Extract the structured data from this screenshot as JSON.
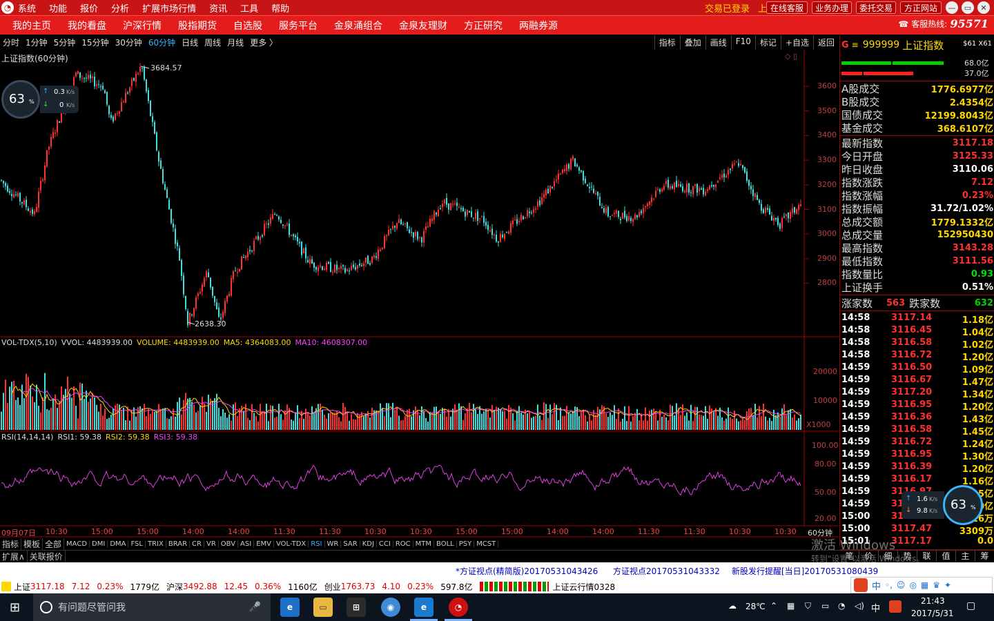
{
  "title_bar": {
    "menus": [
      "系统",
      "功能",
      "报价",
      "分析",
      "扩展市场行情",
      "资讯",
      "工具",
      "帮助"
    ],
    "status": "交易已登录",
    "index_name": "上证指数",
    "buttons": [
      "在线客服",
      "业务办理",
      "委托交易",
      "方正网站"
    ],
    "window_controls": [
      "—",
      "▭",
      "✕"
    ]
  },
  "nav": {
    "items": [
      "我的主页",
      "我的看盘",
      "沪深行情",
      "股指期货",
      "自选股",
      "服务平台",
      "金泉涌组合",
      "金泉友理财",
      "方正研究",
      "两融券源"
    ],
    "hotline_label": "客服热线:",
    "hotline_number": "95571"
  },
  "period_bar": {
    "periods": [
      "分时",
      "1分钟",
      "5分钟",
      "15分钟",
      "30分钟",
      "60分钟",
      "日线",
      "周线",
      "月线",
      "更多 〉"
    ],
    "active_index": 5,
    "tools": [
      "指标",
      "叠加",
      "画线",
      "F10",
      "标记",
      "+自选",
      "返回"
    ]
  },
  "main_chart": {
    "title": "上证指数(60分钟)",
    "high_label": "3684.57",
    "low_label": "2638.30",
    "y_ticks": [
      "3600",
      "3500",
      "3400",
      "3300",
      "3200",
      "3100",
      "3000",
      "2900",
      "2800"
    ],
    "colors": {
      "up": "#ff3030",
      "down": "#40e0e0",
      "axis": "#a00000"
    }
  },
  "volume_chart": {
    "label": "VOL-TDX(5,10)",
    "vvol": "VVOL: 4483939.00",
    "volume": "VOLUME: 4483939.00",
    "ma5": "MA5: 4364083.00",
    "ma10": "MA10: 4608307.00",
    "y_ticks": [
      "20000",
      "10000"
    ],
    "unit": "X1000"
  },
  "rsi_chart": {
    "label": "RSI(14,14,14)",
    "rsi1": "RSI1: 59.38",
    "rsi2": "RSI2: 59.38",
    "rsi3": "RSI3: 59.38",
    "y_ticks": [
      "100.00",
      "80.00",
      "50.00",
      "20.00"
    ]
  },
  "time_axis": {
    "first": "09月07日",
    "labels": [
      "10:30",
      "15:00",
      "15:00",
      "14:00",
      "14:00",
      "11:30",
      "11:30",
      "10:30",
      "10:30",
      "15:00",
      "15:00",
      "14:00",
      "14:00",
      "11:30",
      "11:30",
      "10:30",
      "10:30"
    ],
    "period_label": "60分钟"
  },
  "speed_gauge_left": {
    "percent": "63",
    "unit": "%",
    "up": "0.3",
    "down": "0",
    "rate_unit": "K/s"
  },
  "speed_gauge_right": {
    "percent": "63",
    "unit": "%",
    "up": "1.6",
    "down": "9.8",
    "rate_unit": "K/s"
  },
  "right_panel": {
    "letter": "G",
    "menu_icon": "≡",
    "code": "999999",
    "name": "上证指数",
    "tag": "$61 X61",
    "bar_pcts": [
      "68.0亿",
      "37.0亿"
    ],
    "turnover": [
      {
        "k": "A股成交",
        "v": "1776.6977亿"
      },
      {
        "k": "B股成交",
        "v": "2.4354亿"
      },
      {
        "k": "国债成交",
        "v": "12199.8043亿"
      },
      {
        "k": "基金成交",
        "v": "368.6107亿"
      }
    ],
    "stats": [
      {
        "k": "最新指数",
        "v": "3117.18",
        "c": "red"
      },
      {
        "k": "今日开盘",
        "v": "3125.33",
        "c": "red"
      },
      {
        "k": "昨日收盘",
        "v": "3110.06",
        "c": "white"
      },
      {
        "k": "指数涨跌",
        "v": "7.12",
        "c": "red"
      },
      {
        "k": "指数涨幅",
        "v": "0.23%",
        "c": "red"
      },
      {
        "k": "指数振幅",
        "v": "31.72/1.02%",
        "c": "white"
      },
      {
        "k": "总成交额",
        "v": "1779.1332亿",
        "c": "yellow"
      },
      {
        "k": "总成交量",
        "v": "152950430",
        "c": "yellow"
      },
      {
        "k": "最高指数",
        "v": "3143.28",
        "c": "red"
      },
      {
        "k": "最低指数",
        "v": "3111.56",
        "c": "red"
      },
      {
        "k": "指数量比",
        "v": "0.93",
        "c": "green"
      },
      {
        "k": "上证换手",
        "v": "0.51%",
        "c": "white"
      }
    ],
    "rise_label": "涨家数",
    "rise": "563",
    "fall_label": "跌家数",
    "fall": "632",
    "ticks": [
      {
        "t": "14:58",
        "p": "3117.14",
        "a": "1.18亿"
      },
      {
        "t": "14:58",
        "p": "3116.45",
        "a": "1.04亿"
      },
      {
        "t": "14:58",
        "p": "3116.58",
        "a": "1.02亿"
      },
      {
        "t": "14:58",
        "p": "3116.72",
        "a": "1.20亿"
      },
      {
        "t": "14:59",
        "p": "3116.50",
        "a": "1.09亿"
      },
      {
        "t": "14:59",
        "p": "3116.67",
        "a": "1.47亿"
      },
      {
        "t": "14:59",
        "p": "3117.20",
        "a": "1.34亿"
      },
      {
        "t": "14:59",
        "p": "3116.95",
        "a": "1.20亿"
      },
      {
        "t": "14:59",
        "p": "3116.36",
        "a": "1.43亿"
      },
      {
        "t": "14:59",
        "p": "3116.58",
        "a": "1.45亿"
      },
      {
        "t": "14:59",
        "p": "3116.72",
        "a": "1.24亿"
      },
      {
        "t": "14:59",
        "p": "3116.95",
        "a": "1.30亿"
      },
      {
        "t": "14:59",
        "p": "3116.39",
        "a": "1.20亿"
      },
      {
        "t": "14:59",
        "p": "3116.17",
        "a": "1.16亿"
      },
      {
        "t": "14:59",
        "p": "3116.97",
        "a": "1.35亿"
      },
      {
        "t": "14:59",
        "p": "3116.97",
        "a": "1.40亿"
      },
      {
        "t": "15:00",
        "p": "3117.47",
        "a": "1.26万"
      },
      {
        "t": "15:00",
        "p": "3117.47",
        "a": "3309万"
      },
      {
        "t": "15:01",
        "p": "3117.17",
        "a": "0.0"
      }
    ],
    "bottom_tabs": [
      "笔",
      "价",
      "细",
      "势",
      "联",
      "值",
      "主",
      "筹"
    ]
  },
  "indicator_tabs": [
    "指标",
    "模板",
    "全部",
    "MACD",
    "DMI",
    "DMA",
    "FSL",
    "TRIX",
    "BRAR",
    "CR",
    "VR",
    "OBV",
    "ASI",
    "EMV",
    "VOL-TDX",
    "RSI",
    "WR",
    "SAR",
    "KDJ",
    "CCI",
    "ROC",
    "MTM",
    "BOLL",
    "PSY",
    "MCST"
  ],
  "indicator_active": "RSI",
  "extra_tabs": [
    "扩展∧",
    "关联报价"
  ],
  "news": [
    "*方证视点(精简版)20170531043426",
    "方证视点20170531043332",
    "新股发行提醒[当日]20170531080439"
  ],
  "quotes": {
    "sh_label": "上证",
    "sh_price": "3117.18",
    "sh_chg": "7.12",
    "sh_pct": "0.23%",
    "sh_amt": "1779亿",
    "sz_label": "沪深",
    "sz_price": "3492.88",
    "sz_chg": "12.45",
    "sz_pct": "0.36%",
    "sz_amt": "1160亿",
    "cy_label": "创业",
    "cy_price": "1763.73",
    "cy_chg": "4.10",
    "cy_pct": "0.23%",
    "cy_amt": "597.8亿",
    "cloud": "上证云行情0328"
  },
  "watermark": {
    "line1": "激活 Windows",
    "line2": "转到\"设置\"以激活 Windows。"
  },
  "taskbar": {
    "search_placeholder": "有问题尽管问我",
    "weather": "28℃",
    "ime": "中",
    "time": "21:43",
    "date": "2017/5/31"
  }
}
